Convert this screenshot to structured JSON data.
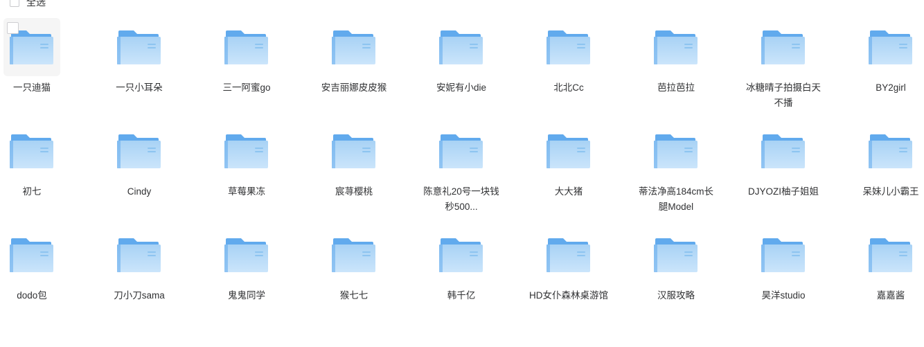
{
  "header": {
    "select_all_label": "全选",
    "checkbox_checked": false
  },
  "theme": {
    "folder_tab_color": "#61aaed",
    "folder_body_top": "#a8d2f5",
    "folder_body_bottom": "#cbe5fb",
    "folder_line_color": "#8dc4f0",
    "text_color": "#303133",
    "hover_bg": "#f5f5f5",
    "checkbox_border": "#cfcfd2",
    "page_bg": "#ffffff"
  },
  "grid": {
    "columns": 9,
    "rows": 3,
    "icon_name": "folder-icon",
    "items": [
      {
        "label": "一只迪猫",
        "hovered": true,
        "checked": false
      },
      {
        "label": "一只小耳朵",
        "hovered": false,
        "checked": false
      },
      {
        "label": "三一阿蜜go",
        "hovered": false,
        "checked": false
      },
      {
        "label": "安吉丽娜皮皮猴",
        "hovered": false,
        "checked": false
      },
      {
        "label": "安妮有小die",
        "hovered": false,
        "checked": false
      },
      {
        "label": "北北Cc",
        "hovered": false,
        "checked": false
      },
      {
        "label": "芭拉芭拉",
        "hovered": false,
        "checked": false
      },
      {
        "label": "冰糖晴子拍摄白天不播",
        "hovered": false,
        "checked": false
      },
      {
        "label": "BY2girl",
        "hovered": false,
        "checked": false
      },
      {
        "label": "初七",
        "hovered": false,
        "checked": false
      },
      {
        "label": "Cindy",
        "hovered": false,
        "checked": false
      },
      {
        "label": "草莓果冻",
        "hovered": false,
        "checked": false
      },
      {
        "label": "宸荨樱桃",
        "hovered": false,
        "checked": false
      },
      {
        "label": "陈意礼20号一块钱秒500...",
        "hovered": false,
        "checked": false
      },
      {
        "label": "大大猪",
        "hovered": false,
        "checked": false
      },
      {
        "label": "蒂法净高184cm长腿Model",
        "hovered": false,
        "checked": false
      },
      {
        "label": "DJYOZI柚子姐姐",
        "hovered": false,
        "checked": false
      },
      {
        "label": "呆妹儿小霸王",
        "hovered": false,
        "checked": false
      },
      {
        "label": "dodo包",
        "hovered": false,
        "checked": false
      },
      {
        "label": "刀小刀sama",
        "hovered": false,
        "checked": false
      },
      {
        "label": "鬼鬼同学",
        "hovered": false,
        "checked": false
      },
      {
        "label": "猴七七",
        "hovered": false,
        "checked": false
      },
      {
        "label": "韩千亿",
        "hovered": false,
        "checked": false
      },
      {
        "label": "HD女仆森林桌游馆",
        "hovered": false,
        "checked": false
      },
      {
        "label": "汉服攻略",
        "hovered": false,
        "checked": false
      },
      {
        "label": "昊洋studio",
        "hovered": false,
        "checked": false
      },
      {
        "label": "嘉嘉酱",
        "hovered": false,
        "checked": false
      }
    ]
  }
}
